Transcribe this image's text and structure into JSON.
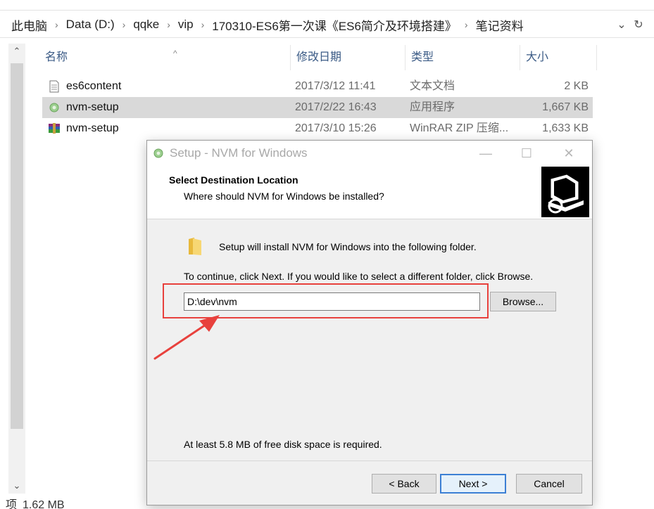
{
  "explorer": {
    "breadcrumbs": [
      "此电脑",
      "Data (D:)",
      "qqke",
      "vip",
      "170310-ES6第一次课《ES6简介及环境搭建》",
      "笔记资料"
    ],
    "columns": {
      "name": "名称",
      "date": "修改日期",
      "type": "类型",
      "size": "大小"
    },
    "files": [
      {
        "icon": "text-document-icon",
        "name": "es6content",
        "date": "2017/3/12 11:41",
        "type": "文本文档",
        "size": "2 KB",
        "selected": false
      },
      {
        "icon": "nvm-setup-icon",
        "name": "nvm-setup",
        "date": "2017/2/22 16:43",
        "type": "应用程序",
        "size": "1,667 KB",
        "selected": true
      },
      {
        "icon": "winrar-archive-icon",
        "name": "nvm-setup",
        "date": "2017/3/10 15:26",
        "type": "WinRAR ZIP 压缩...",
        "size": "1,633 KB",
        "selected": false
      }
    ],
    "status": {
      "items_text": "项",
      "size": "1.62 MB"
    }
  },
  "dialog": {
    "title": "Setup - NVM for Windows",
    "header_title": "Select Destination Location",
    "header_subtitle": "Where should NVM for Windows be installed?",
    "install_text": "Setup will install NVM for Windows into the following folder.",
    "continue_text": "To continue, click Next. If you would like to select a different folder, click Browse.",
    "path_value": "D:\\dev\\nvm",
    "browse_label": "Browse...",
    "disk_space_text": "At least 5.8 MB of free disk space is required.",
    "back_label": "< Back",
    "next_label": "Next >",
    "cancel_label": "Cancel"
  },
  "colors": {
    "annotation_red": "#e8413d",
    "selected_row": "#d9d9d9",
    "header_text_blue": "#3a5a85",
    "default_button_border": "#3c7fd4"
  }
}
